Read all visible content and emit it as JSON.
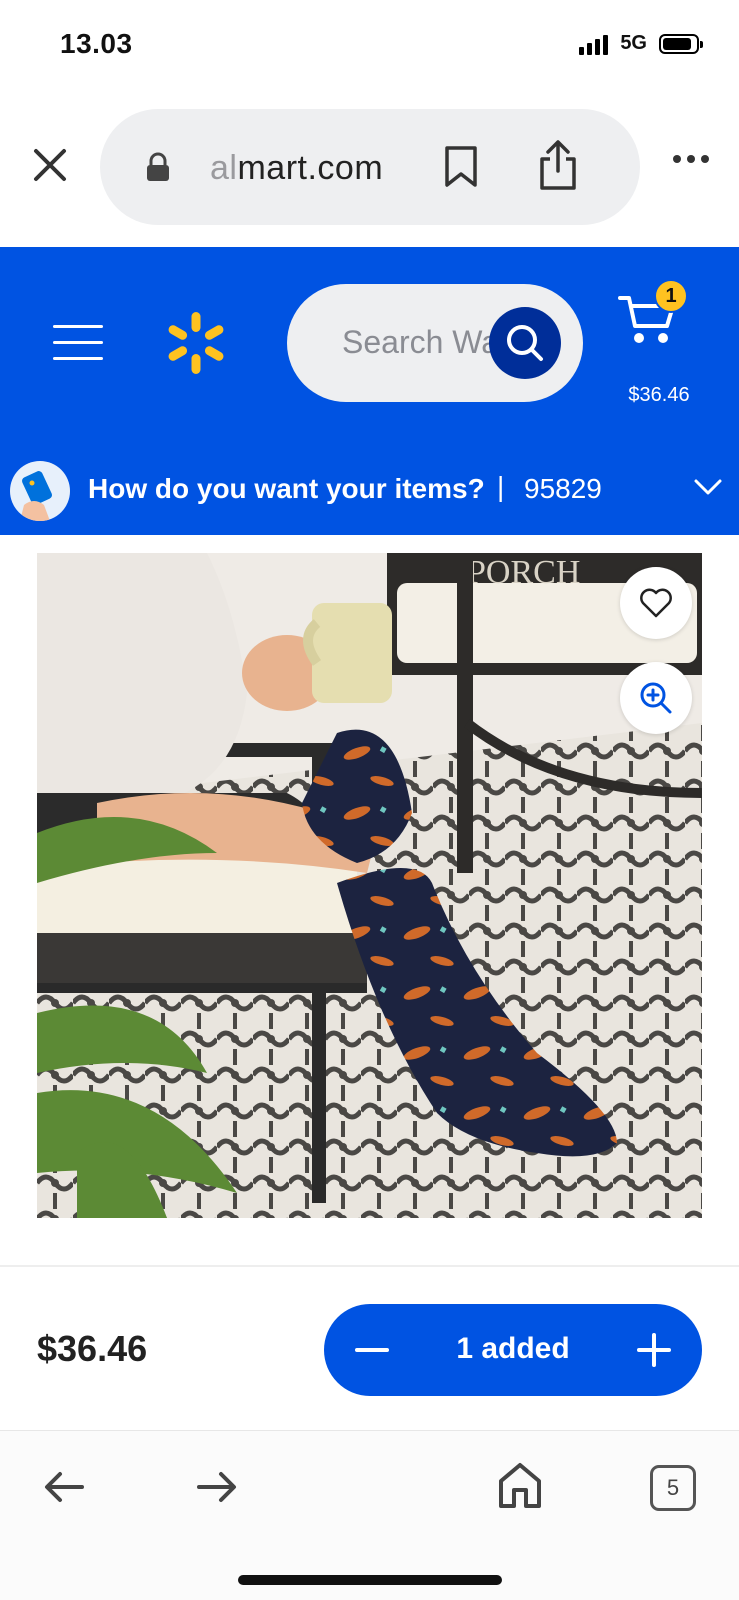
{
  "status_bar": {
    "time": "13.03",
    "network": "5G",
    "icons": [
      "signal-icon",
      "battery-icon"
    ]
  },
  "browser": {
    "url_faded": "al",
    "url_main": "mart.com",
    "icons": [
      "close-icon",
      "lock-icon",
      "bookmark-icon",
      "share-icon",
      "more-icon"
    ]
  },
  "header": {
    "search_placeholder": "Search Wa",
    "cart_count": "1",
    "cart_total": "$36.46",
    "brand_color": "#0053e2",
    "accent_color": "#ffc220",
    "icons": [
      "menu-icon",
      "spark-logo-icon",
      "search-icon",
      "cart-icon"
    ]
  },
  "delivery": {
    "prompt": "How do you want your items?",
    "separator": "|",
    "zip": "95829",
    "icons": [
      "chevron-down-icon"
    ]
  },
  "product": {
    "icons": [
      "heart-icon",
      "zoom-in-icon"
    ]
  },
  "purchase": {
    "price": "$36.46",
    "quantity_label": "1 added",
    "icons": [
      "minus-icon",
      "plus-icon"
    ]
  },
  "toolbar": {
    "tab_count": "5",
    "icons": [
      "back-arrow-icon",
      "forward-arrow-icon",
      "home-icon"
    ]
  }
}
